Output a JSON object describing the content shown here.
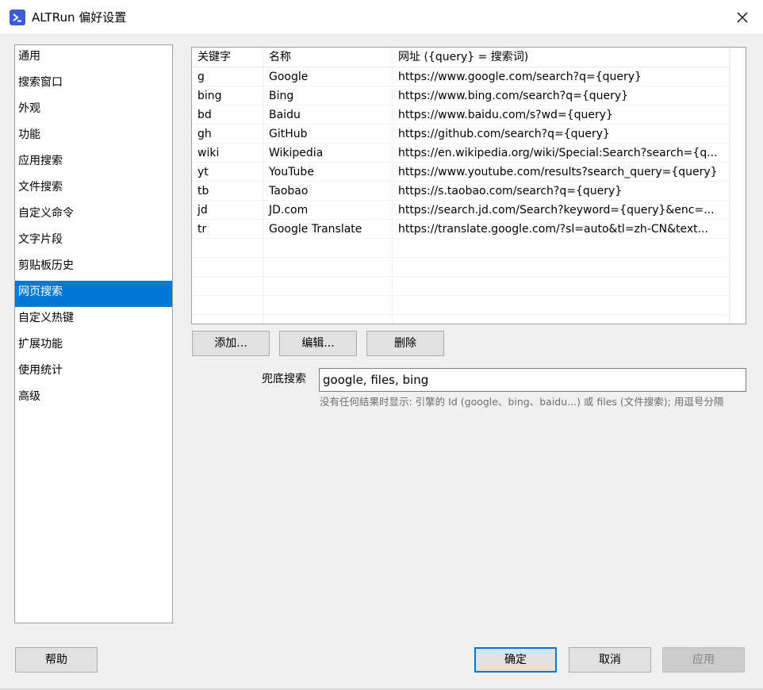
{
  "window": {
    "title": "ALTRun 偏好设置",
    "app_icon": "terminal-prompt-icon",
    "close_icon": "close-icon",
    "accent": "#0078d7"
  },
  "sidebar": {
    "items": [
      {
        "label": "通用"
      },
      {
        "label": "搜索窗口"
      },
      {
        "label": "外观"
      },
      {
        "label": "功能"
      },
      {
        "label": "应用搜索"
      },
      {
        "label": "文件搜索"
      },
      {
        "label": "自定义命令"
      },
      {
        "label": "文字片段"
      },
      {
        "label": "剪贴板历史"
      },
      {
        "label": "网页搜索",
        "selected": true
      },
      {
        "label": "自定义热键"
      },
      {
        "label": "扩展功能"
      },
      {
        "label": "使用统计"
      },
      {
        "label": "高级"
      }
    ]
  },
  "table": {
    "columns": [
      "关键字",
      "名称",
      "网址 ({query} = 搜索词)"
    ],
    "rows": [
      [
        "g",
        "Google",
        "https://www.google.com/search?q={query}"
      ],
      [
        "bing",
        "Bing",
        "https://www.bing.com/search?q={query}"
      ],
      [
        "bd",
        "Baidu",
        "https://www.baidu.com/s?wd={query}"
      ],
      [
        "gh",
        "GitHub",
        "https://github.com/search?q={query}"
      ],
      [
        "wiki",
        "Wikipedia",
        "https://en.wikipedia.org/wiki/Special:Search?search={q..."
      ],
      [
        "yt",
        "YouTube",
        "https://www.youtube.com/results?search_query={query}"
      ],
      [
        "tb",
        "Taobao",
        "https://s.taobao.com/search?q={query}"
      ],
      [
        "jd",
        "JD.com",
        "https://search.jd.com/Search?keyword={query}&enc=..."
      ],
      [
        "tr",
        "Google Translate",
        "https://translate.google.com/?sl=auto&tl=zh-CN&text..."
      ]
    ]
  },
  "actions": {
    "add": "添加...",
    "edit": "编辑...",
    "delete": "删除"
  },
  "fallback": {
    "label": "兜底搜索",
    "value": "google, files, bing",
    "hint": "没有任何结果时显示: 引擎的 Id (google、bing、baidu...) 或 files (文件搜索); 用逗号分隔"
  },
  "footer": {
    "help": "帮助",
    "ok": "确定",
    "cancel": "取消",
    "apply": "应用"
  }
}
